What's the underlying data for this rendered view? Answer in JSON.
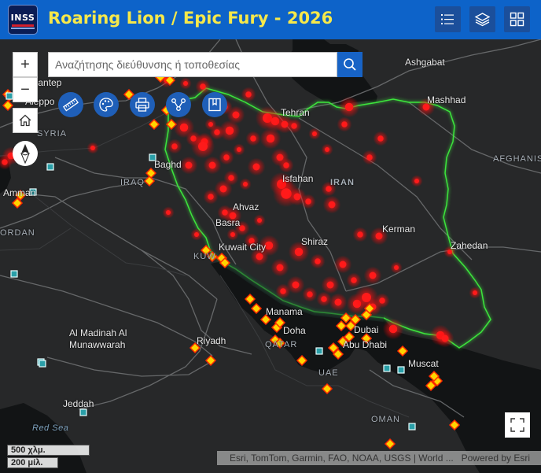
{
  "header": {
    "logo_text": "INSS",
    "title": "Roaring Lion / Epic Fury - 2026",
    "buttons": [
      {
        "name": "legend-button",
        "icon": "list-icon"
      },
      {
        "name": "layers-button",
        "icon": "layers-icon"
      },
      {
        "name": "basemap-gallery-button",
        "icon": "grid-icon"
      }
    ]
  },
  "search": {
    "placeholder": "Αναζήτησης διεύθυνσης ή τοποθεσίας",
    "button_icon": "search-icon"
  },
  "map_controls": {
    "zoom_in": "+",
    "zoom_out": "−",
    "home_icon": "home-icon",
    "compass_icon": "compass-icon",
    "fullscreen_icon": "fullscreen-icon"
  },
  "tools": [
    {
      "name": "measure-tool",
      "icon": "ruler-icon"
    },
    {
      "name": "sketch-tool",
      "icon": "palette-icon"
    },
    {
      "name": "print-tool",
      "icon": "printer-icon"
    },
    {
      "name": "share-tool",
      "icon": "share-icon"
    },
    {
      "name": "bookmarks-tool",
      "icon": "bookmark-icon"
    }
  ],
  "scale": {
    "km": "500 χλμ.",
    "mi": "200 μίλ."
  },
  "attribution": {
    "text": "Esri, TomTom, Garmin, FAO, NOAA, USGS | World ...",
    "powered": "Powered by Esri"
  },
  "labels": {
    "ashgabat": "Ashgabat",
    "mashhad": "Mashhad",
    "tehran": "Tehran",
    "afghanistan": "AFGHANIS",
    "isfahan": "Isfahan",
    "iran": "IRAN",
    "ahvaz": "Ahvaz",
    "kerman": "Kerman",
    "basra": "Basra",
    "shiraz": "Shiraz",
    "zahedan": "Zahedan",
    "kuwait_city": "Kuwait City",
    "kuw": "KUW",
    "manama": "Manama",
    "doha": "Doha",
    "qatar": "QATAR",
    "dubai": "Dubai",
    "abu_dhabi": "Abu Dhabi",
    "riyadh": "Riyadh",
    "muscat": "Muscat",
    "uae": "UAE",
    "medina_1": "Al Madinah Al",
    "medina_2": "Munawwarah",
    "jeddah": "Jeddah",
    "red_sea": "Red Sea",
    "oman": "OMAN",
    "baghdad": "Baghd",
    "iraq": "IRAQ",
    "amman": "Amman",
    "jordan": "ORDAN",
    "syria": "SYRIA",
    "aleppo": "Aleppo",
    "gaziantep": "aziantep"
  },
  "colors": {
    "header": "#0d63c9",
    "title": "#f6e84a",
    "strike_red": "#ff1a1a",
    "diamond_fill": "#ffd400",
    "diamond_stroke": "#ff2a00",
    "iran_border": "#3ef03e"
  }
}
